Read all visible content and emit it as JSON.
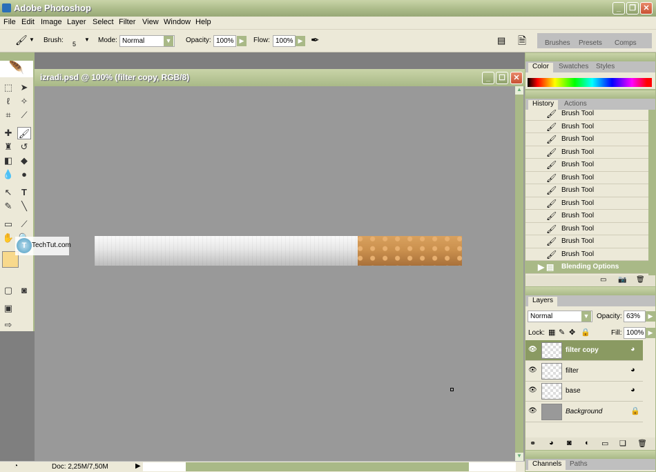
{
  "app": {
    "title": "Adobe Photoshop"
  },
  "menu": [
    "File",
    "Edit",
    "Image",
    "Layer",
    "Select",
    "Filter",
    "View",
    "Window",
    "Help"
  ],
  "options": {
    "brush_label": "Brush:",
    "brush_size": "5",
    "mode_label": "Mode:",
    "mode_value": "Normal",
    "opacity_label": "Opacity:",
    "opacity_value": "100%",
    "flow_label": "Flow:",
    "flow_value": "100%"
  },
  "well_tabs": [
    "Brushes",
    "Presets",
    "Comps"
  ],
  "document": {
    "title": "izradi.psd @ 100% (filter copy, RGB/8)",
    "status": "Doc: 2,25M/7,50M"
  },
  "watermark": "TechTut.com",
  "colors": {
    "foreground": "#f8d98c",
    "background": "#a0a0a0",
    "chrome_green": "#a9b987",
    "filter_tip": "#c98f4d"
  },
  "color_panel": {
    "tabs": [
      "Color",
      "Swatches",
      "Styles"
    ]
  },
  "history_panel": {
    "tabs": [
      "History",
      "Actions"
    ],
    "items": [
      "Brush Tool",
      "Brush Tool",
      "Brush Tool",
      "Brush Tool",
      "Brush Tool",
      "Brush Tool",
      "Brush Tool",
      "Brush Tool",
      "Brush Tool",
      "Brush Tool",
      "Brush Tool",
      "Brush Tool"
    ],
    "selected": "Blending Options"
  },
  "layers_panel": {
    "tab": "Layers",
    "blend_mode": "Normal",
    "opacity_label": "Opacity:",
    "opacity": "63%",
    "lock_label": "Lock:",
    "fill_label": "Fill:",
    "fill": "100%",
    "layers": [
      {
        "name": "filter copy",
        "selected": true
      },
      {
        "name": "filter"
      },
      {
        "name": "base"
      },
      {
        "name": "Background",
        "locked": true
      }
    ]
  },
  "bottom_panel": {
    "tabs": [
      "Channels",
      "Paths"
    ]
  }
}
